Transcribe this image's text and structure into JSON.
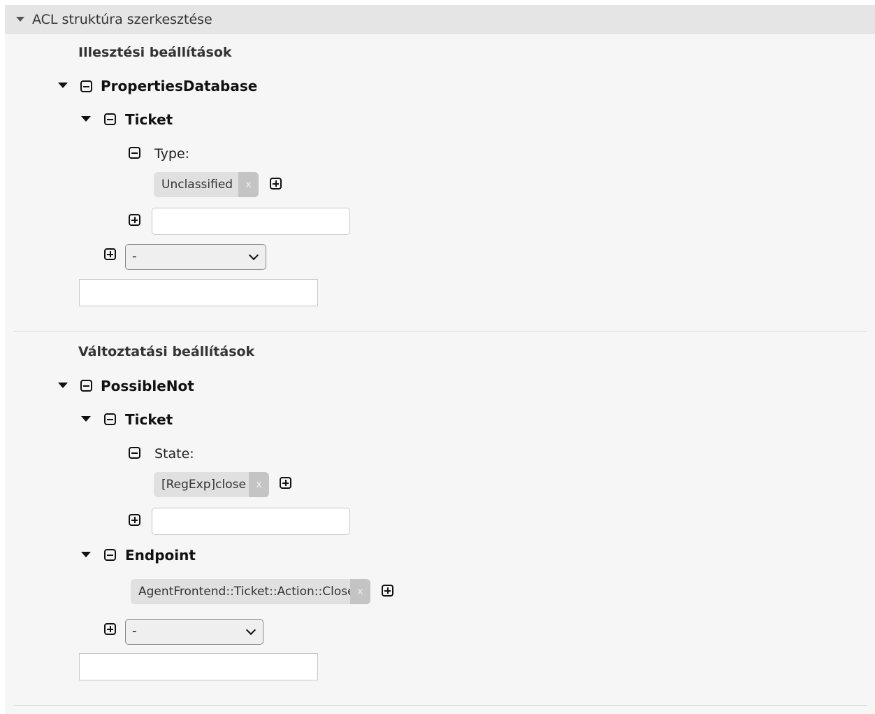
{
  "header": {
    "title": "ACL struktúra szerkesztése"
  },
  "match": {
    "title": "Illesztési beállítások",
    "root": "PropertiesDatabase",
    "object": "Ticket",
    "field": "Type:",
    "value": "Unclassified",
    "remove_label": "x",
    "select_value": "-"
  },
  "change": {
    "title": "Változtatási beállítások",
    "root": "PossibleNot",
    "object": "Ticket",
    "field": "State:",
    "value": "[RegExp]close",
    "remove_label": "x",
    "endpoint_label": "Endpoint",
    "endpoint_value": "AgentFrontend::Ticket::Action::Close",
    "endpoint_remove_label": "x",
    "select_value": "-"
  }
}
